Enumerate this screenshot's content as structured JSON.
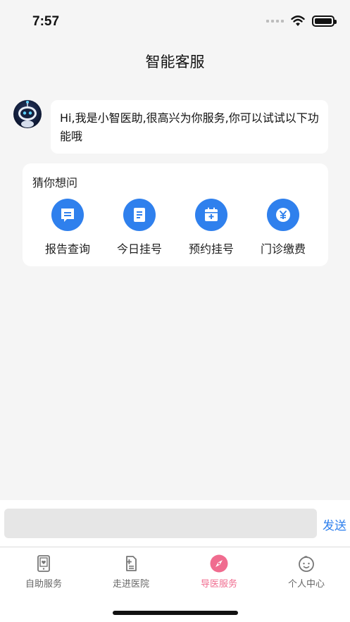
{
  "status_bar": {
    "time": "7:57"
  },
  "header": {
    "title": "智能客服"
  },
  "chat": {
    "bot_message": "Hi,我是小智医助,很高兴为你服务,你可以试试以下功能哦"
  },
  "guess_card": {
    "title": "猜你想问",
    "items": [
      {
        "label": "报告查询",
        "icon": "message-report-icon"
      },
      {
        "label": "今日挂号",
        "icon": "document-icon"
      },
      {
        "label": "预约挂号",
        "icon": "calendar-plus-icon"
      },
      {
        "label": "门诊缴费",
        "icon": "yuan-coin-icon"
      }
    ]
  },
  "input_bar": {
    "placeholder": "",
    "send_label": "发送"
  },
  "tab_bar": {
    "items": [
      {
        "label": "自助服务",
        "icon": "tablet-heart-icon",
        "active": false
      },
      {
        "label": "走进医院",
        "icon": "clipboard-plus-icon",
        "active": false
      },
      {
        "label": "导医服务",
        "icon": "compass-icon",
        "active": true
      },
      {
        "label": "个人中心",
        "icon": "baby-face-icon",
        "active": false
      }
    ]
  },
  "colors": {
    "accent": "#2f80ed",
    "tab_active": "#f06c8f",
    "background": "#f5f5f5"
  }
}
